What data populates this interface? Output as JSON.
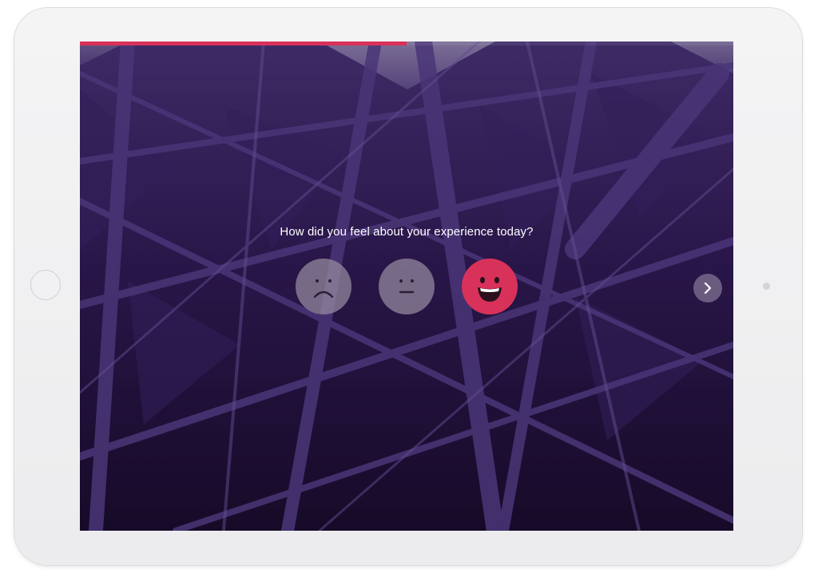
{
  "survey": {
    "question": "How did you feel about your experience today?",
    "progress_fraction": 0.5,
    "options": [
      {
        "icon": "sad-face-icon",
        "selected": false
      },
      {
        "icon": "neutral-face-icon",
        "selected": false
      },
      {
        "icon": "happy-face-icon",
        "selected": true
      }
    ],
    "next_icon": "chevron-right-icon"
  },
  "colors": {
    "accent": "#d8325a",
    "face_inactive": "#968ca0",
    "background": "#1e1033"
  }
}
